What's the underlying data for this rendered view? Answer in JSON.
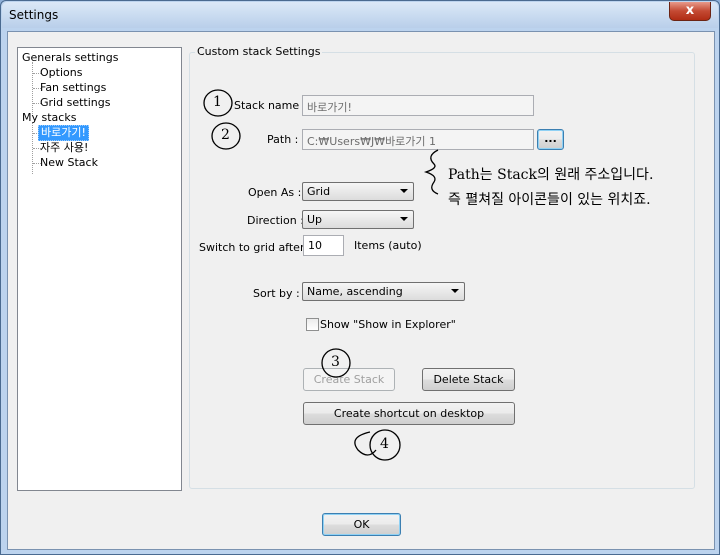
{
  "window": {
    "title": "Settings",
    "close_glyph": "x"
  },
  "tree": {
    "root1": "Generals settings",
    "root1_children": [
      "Options",
      "Fan settings",
      "Grid settings"
    ],
    "root2": "My stacks",
    "root2_children": [
      "바로가기!",
      "자주 사용!",
      "New Stack"
    ]
  },
  "form": {
    "group_title": "Custom stack Settings",
    "stack_name_label": "Stack name :",
    "stack_name_value": "바로가기!",
    "path_label": "Path :",
    "path_value": "C:₩Users₩J₩바로가기 1",
    "browse_label": "...",
    "open_as_label": "Open As :",
    "open_as_value": "Grid",
    "direction_label": "Direction :",
    "direction_value": "Up",
    "switch_label": "Switch to grid after :",
    "switch_value": "10",
    "items_label": "Items (auto)",
    "sort_label": "Sort by :",
    "sort_value": "Name, ascending",
    "show_explorer_label": "Show \"Show in Explorer\"",
    "create_stack": "Create Stack",
    "delete_stack": "Delete Stack",
    "create_shortcut": "Create shortcut on desktop"
  },
  "footer": {
    "ok": "OK"
  },
  "annotations": {
    "num1": "1",
    "num2": "2",
    "num3": "3",
    "num4": "4",
    "note_line1": "Path는 Stack의 원래 주소입니다.",
    "note_line2": "즉 펼쳐질 아이콘들이 있는 위치죠."
  }
}
